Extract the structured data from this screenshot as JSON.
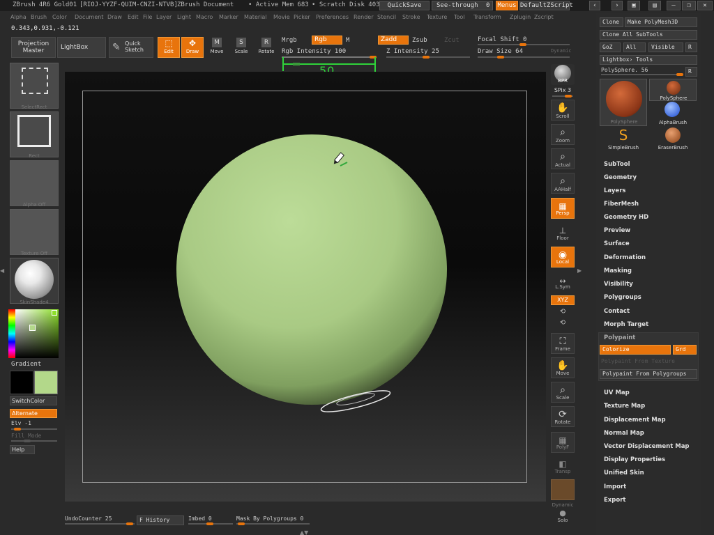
{
  "title_bar": {
    "app": "ZBrush 4R6 Gold01",
    "serial": "[RIOJ-YYZF-QUIM-CNZI-NTVB]",
    "doc": "ZBrush Document",
    "active_mem": "• Active Mem 683",
    "scratch": "• Scratch Disk 403",
    "quicksave": "QuickSave",
    "see_through": "See-through",
    "see_through_val": "0",
    "menus": "Menus",
    "default_script": "DefaultZScript"
  },
  "menu": [
    "Alpha",
    "Brush",
    "Color",
    "Document",
    "Draw",
    "Edit",
    "File",
    "Layer",
    "Light",
    "Macro",
    "Marker",
    "Material",
    "Movie",
    "Picker",
    "Preferences",
    "Render",
    "Stencil",
    "Stroke",
    "Texture",
    "Tool",
    "Transform",
    "Zplugin",
    "Zscript"
  ],
  "coords": "0.343,0.931,-0.121",
  "toolbar": {
    "projection_master": "Projection Master",
    "lightbox": "LightBox",
    "quick_sketch": "Quick Sketch",
    "edit": "Edit",
    "draw": "Draw",
    "move": "Move",
    "scale": "Scale",
    "rotate": "Rotate",
    "mrgb": "Mrgb",
    "rgb": "Rgb",
    "m": "M",
    "zadd": "Zadd",
    "zsub": "Zsub",
    "zcut": "Zcut",
    "rgb_intensity": "Rgb Intensity 100",
    "z_intensity": "Z Intensity 25",
    "focal_shift": "Focal Shift 0",
    "draw_size": "Draw Size 64",
    "dynamic": "Dynamic",
    "annotation": "50"
  },
  "left_shelf": {
    "select_rect": "SelectRect",
    "rect": "Rect",
    "alpha_off": "Alpha Off",
    "texture_off": "Texture Off",
    "material": "SkinShade4",
    "gradient": "Gradient",
    "switch_color": "SwitchColor",
    "alternate": "Alternate",
    "elv": "Elv -1",
    "fill_mode": "Fill Mode",
    "help": "Help",
    "primary_color": "#b3d88a",
    "secondary_color": "#000000"
  },
  "right_shelf": [
    {
      "label": "BPR"
    },
    {
      "label": "SPix 3"
    },
    {
      "label": "Scroll"
    },
    {
      "label": "Zoom"
    },
    {
      "label": "Actual"
    },
    {
      "label": "AAHalf"
    },
    {
      "label": "Persp"
    },
    {
      "label": "Floor"
    },
    {
      "label": "Local"
    },
    {
      "label": "L.Sym"
    },
    {
      "label": "XYZ"
    },
    {
      "label": "Frame"
    },
    {
      "label": "Move"
    },
    {
      "label": "Scale"
    },
    {
      "label": "Rotate"
    },
    {
      "label": "PolyF"
    },
    {
      "label": "Transp"
    },
    {
      "label": "Dynamic"
    },
    {
      "label": "Solo"
    }
  ],
  "palette": {
    "clone": "Clone",
    "make_polymesh": "Make PolyMesh3D",
    "clone_all": "Clone All SubTools",
    "goz": "GoZ",
    "all": "All",
    "visible": "Visible",
    "r": "R",
    "lightbox_tools": "Lightbox› Tools",
    "polysphere": "PolySphere. 56",
    "r2": "R",
    "thumbs": [
      "PolySphere",
      "PolySphere",
      "AlphaBrush",
      "SimpleBrush",
      "EraserBrush"
    ],
    "sections": [
      "SubTool",
      "Geometry",
      "Layers",
      "FiberMesh",
      "Geometry HD",
      "Preview",
      "Surface",
      "Deformation",
      "Masking",
      "Visibility",
      "Polygroups",
      "Contact",
      "Morph Target"
    ],
    "polypaint": "Polypaint",
    "colorize": "Colorize",
    "grd": "Grd",
    "polypaint_from_texture": "Polypaint From Texture",
    "polypaint_from_polygroups": "Polypaint From Polygroups",
    "sections2": [
      "UV Map",
      "Texture Map",
      "Displacement Map",
      "Normal Map",
      "Vector Displacement Map",
      "Display Properties",
      "Unified Skin",
      "Import",
      "Export"
    ]
  },
  "bottom": {
    "undo_counter": "UndoCounter 25",
    "f_history": "F History",
    "imbed": "Imbed 0",
    "mask_by_polygroups": "Mask By Polygroups 0"
  },
  "sphere_color": "#b5d88e"
}
